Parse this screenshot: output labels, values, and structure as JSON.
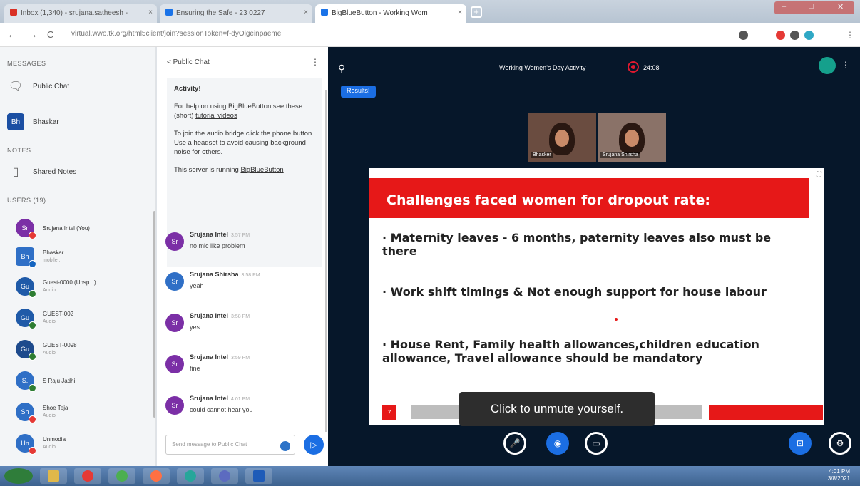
{
  "browser": {
    "tabs": [
      {
        "label": "Inbox (1,340) - srujana.satheesh - ",
        "color": "#d93025"
      },
      {
        "label": "Ensuring the Safe - 23 0227",
        "color": "#1a73e8"
      },
      {
        "label": "BigBlueButton - Working Wom",
        "color": "#1a73e8"
      }
    ],
    "new_tab": "+",
    "url": "virtual.wwo.tk.org/html5client/join?sessionToken=f-dyOlgeinpaeme",
    "nav_back": "←",
    "nav_forward": "→",
    "nav_reload": "C"
  },
  "sidebar": {
    "messages_title": "MESSAGES",
    "public_chat": "Public Chat",
    "user_chat": "Bhaskar",
    "notes_title": "NOTES",
    "shared_notes": "Shared Notes",
    "users_title": "USERS (19)",
    "users": [
      {
        "initials": "Sr",
        "name": "Srujana Intel (You)",
        "sub": "",
        "color": "#7b2fa6",
        "badge": "#e53935"
      },
      {
        "initials": "Bh",
        "name": "Bhaskar",
        "sub": "mobile...",
        "color": "#2f6fc6",
        "badge": "#1565c0"
      },
      {
        "initials": "Gu",
        "name": "Guest-0000 (Unsp...)",
        "sub": "Audio",
        "color": "#1f5aa8",
        "badge": "#2e7d32"
      },
      {
        "initials": "Gu",
        "name": "GUEST-002",
        "sub": "Audio",
        "color": "#1f5aa8",
        "badge": "#2e7d32"
      },
      {
        "initials": "Gu",
        "name": "GUEST-0098",
        "sub": "Audio",
        "color": "#1d4a8c",
        "badge": "#2e7d32"
      },
      {
        "initials": "S.",
        "name": "S Raju Jadhi",
        "sub": "",
        "color": "#2f6fc6",
        "badge": "#2e7d32"
      },
      {
        "initials": "Sh",
        "name": "Shoe Teja",
        "sub": "Audio",
        "color": "#2f6fc6",
        "badge": "#e53935"
      },
      {
        "initials": "Un",
        "name": "Unmodia",
        "sub": "Audio",
        "color": "#2f6fc6",
        "badge": "#e53935"
      }
    ]
  },
  "chat": {
    "header": "< Public Chat",
    "welcome": {
      "heading": "Activity!",
      "p1a": "For help on using BigBlueButton see these (short) ",
      "p1link": "tutorial videos",
      "p2": "To join the audio bridge click the phone button. Use a headset to avoid causing background noise for others.",
      "p3a": "This server is running ",
      "p3link": "BigBlueButton"
    },
    "messages": [
      {
        "initials": "Sr",
        "color": "#7b2fa6",
        "name": "Srujana Intel",
        "time": "3:57 PM",
        "text": "no mic like problem"
      },
      {
        "initials": "Sr",
        "color": "#2f6fc6",
        "name": "Srujana Shirsha",
        "time": "3:58 PM",
        "text": "yeah"
      },
      {
        "initials": "Sr",
        "color": "#7b2fa6",
        "name": "Srujana Intel",
        "time": "3:58 PM",
        "text": "yes"
      },
      {
        "initials": "Sr",
        "color": "#7b2fa6",
        "name": "Srujana Intel",
        "time": "3:59 PM",
        "text": "fine"
      },
      {
        "initials": "Sr",
        "color": "#7b2fa6",
        "name": "Srujana Intel",
        "time": "4:01 PM",
        "text": "could cannot hear you"
      }
    ],
    "input_placeholder": "Send message to Public Chat",
    "send": "▷"
  },
  "meeting": {
    "title": "Working Women's Day Activity",
    "recording_time": "24:08",
    "results_button": "Results!",
    "videos": [
      {
        "name": "Bhasker"
      },
      {
        "name": "Srujana Shirsha"
      }
    ],
    "slide": {
      "title": "Challenges faced women for dropout rate:",
      "bullets": [
        "· Maternity leaves - 6 months, paternity leaves also must be there",
        "· Work shift timings & Not enough support for house labour",
        "· House Rent, Family health allowances,children education allowance, Travel allowance should be mandatory"
      ],
      "slide_num": "7"
    },
    "toast": "Click  to unmute yourself.",
    "controls": {
      "mute": "🎤",
      "video": "◉",
      "screen": "▭",
      "present": "⊡",
      "settings": "⚙"
    }
  },
  "taskbar": {
    "time": "4:01 PM",
    "date": "3/8/2021"
  }
}
